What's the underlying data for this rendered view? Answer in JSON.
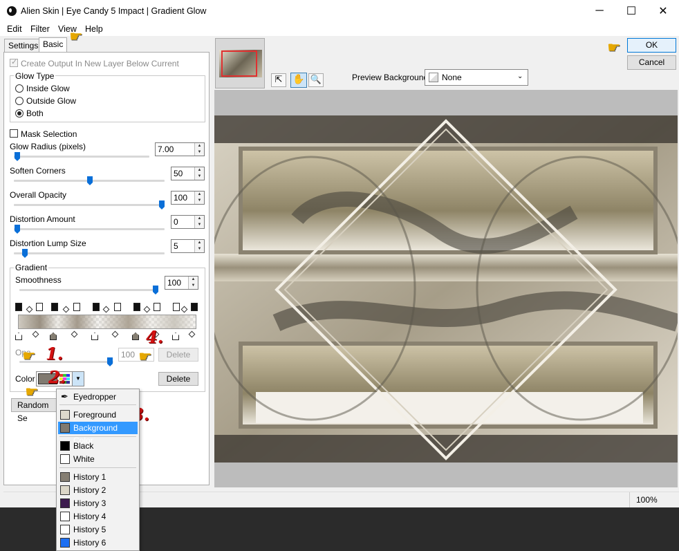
{
  "window": {
    "title": "Alien Skin | Eye Candy 5 Impact | Gradient Glow",
    "minimize": "─",
    "maximize": "☐",
    "close": "✕"
  },
  "menu": [
    "Edit",
    "Filter",
    "View",
    "Help"
  ],
  "tabs": [
    "Settings",
    "Basic"
  ],
  "basic": {
    "create_output_label": "Create Output In New Layer Below Current",
    "glow_type_title": "Glow Type",
    "glow_type_options": [
      "Inside Glow",
      "Outside Glow",
      "Both"
    ],
    "glow_type_selected": "Both",
    "mask_selection_label": "Mask Selection",
    "glow_radius_label": "Glow Radius (pixels)",
    "glow_radius_value": "7.00",
    "soften_corners_label": "Soften Corners",
    "soften_corners_value": "50",
    "overall_opacity_label": "Overall Opacity",
    "overall_opacity_value": "100",
    "distortion_amount_label": "Distortion Amount",
    "distortion_amount_value": "0",
    "distortion_lump_label": "Distortion Lump Size",
    "distortion_lump_value": "5",
    "gradient_title": "Gradient",
    "smoothness_label": "Smoothness",
    "smoothness_value": "100",
    "opacity_label": "Opa",
    "opacity_value": "100",
    "delete_label": "Delete",
    "color_label": "Color",
    "random_label": "Random Se"
  },
  "color_menu": {
    "eyedropper": "Eyedropper",
    "foreground": "Foreground Color",
    "background": "Background Color",
    "black": "Black",
    "white": "White",
    "history": [
      "History 1",
      "History 2",
      "History 3",
      "History 4",
      "History 5",
      "History 6"
    ]
  },
  "swatch_colors": {
    "foreground": "#ddd9cc",
    "background": "#807a70",
    "black": "#000000",
    "white": "#ffffff",
    "history": [
      "#857e72",
      "#dcd7c8",
      "#3c1b4e",
      "#ffffff",
      "#ffffff",
      "#1d6ff2"
    ]
  },
  "annotations": {
    "n1": "1.",
    "n2": "2.",
    "n3": "3.",
    "n4": "4."
  },
  "buttons": {
    "ok": "OK",
    "cancel": "Cancel"
  },
  "preview": {
    "background_label": "Preview Background:",
    "background_value": "None"
  },
  "status": {
    "zoom": "100%"
  }
}
